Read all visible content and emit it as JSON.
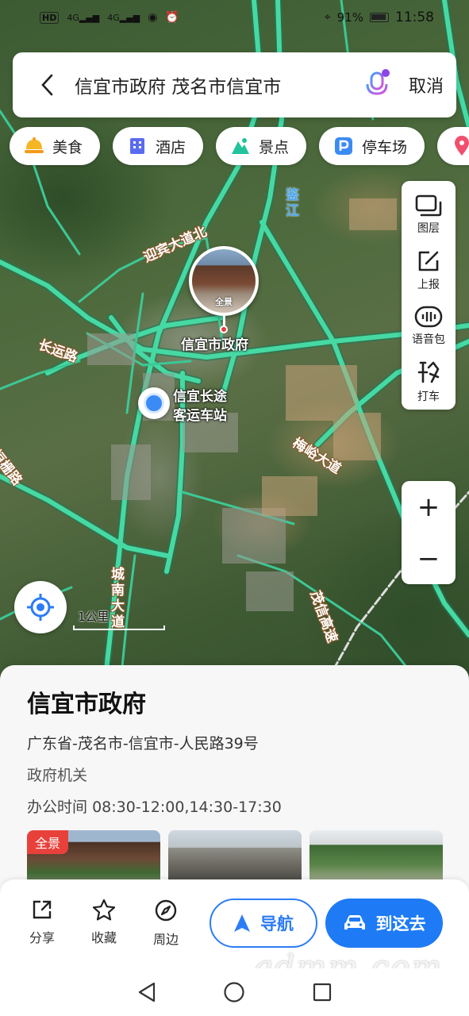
{
  "status_bar": {
    "left_icons": [
      "HD",
      "4G signal",
      "4G signal",
      "eye-icon",
      "alarm-icon"
    ],
    "network_labels": [
      "HD",
      "4G",
      "4G"
    ],
    "battery_percent": "91%",
    "time": "11:58"
  },
  "search": {
    "query": "信宜市政府 茂名市信宜市",
    "cancel_label": "取消"
  },
  "categories": [
    {
      "label": "美食",
      "icon": "food-icon",
      "color": "#f5a623"
    },
    {
      "label": "酒店",
      "icon": "hotel-icon",
      "color": "#5a6cf0"
    },
    {
      "label": "景点",
      "icon": "scenic-icon",
      "color": "#22c39a"
    },
    {
      "label": "停车场",
      "icon": "parking-icon",
      "color": "#3b8bf5"
    }
  ],
  "tools": [
    {
      "label": "图层",
      "icon": "layers-icon"
    },
    {
      "label": "上报",
      "icon": "report-icon"
    },
    {
      "label": "语音包",
      "icon": "voice-pack-icon"
    },
    {
      "label": "打车",
      "icon": "taxi-icon"
    }
  ],
  "zoom": {
    "in_label": "+",
    "out_label": "−"
  },
  "map": {
    "scale_label": "1公里",
    "poi_label": "信宜市政府",
    "poi_photo_label": "全景",
    "station_label_line1": "信宜长途",
    "station_label_line2": "客运车站",
    "road_labels": {
      "yingbin": "迎宾大道北",
      "changyun": "长运路",
      "jianjiang": "鉴江",
      "meiyu": "梅峪大道",
      "chengnan": "城南大道",
      "hengshan": "恒栅路",
      "maoxin": "茂信高速"
    }
  },
  "detail": {
    "name": "信宜市政府",
    "address": "广东省-茂名市-信宜市-人民路39号",
    "category": "政府机关",
    "hours_label": "办公时间",
    "hours_value": "08:30-12:00,14:30-17:30",
    "photo_badge": "全景"
  },
  "actions": {
    "share": "分享",
    "favorite": "收藏",
    "nearby": "周边",
    "navigate": "导航",
    "go_here": "到这去"
  },
  "watermark": "gdmm.com",
  "colors": {
    "accent": "#1e7bf5",
    "road": "#3fd6a0",
    "badge_red": "#e8413b"
  }
}
